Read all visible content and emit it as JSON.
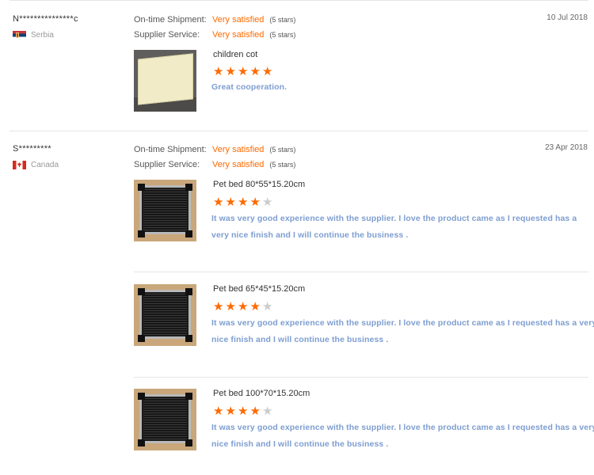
{
  "reviews": [
    {
      "reviewer": "N***************c",
      "country": "Serbia",
      "date": "10 Jul 2018",
      "shipment": {
        "label": "On-time Shipment:",
        "value": "Very satisfied",
        "stars_text": "(5 stars)"
      },
      "service": {
        "label": "Supplier Service:",
        "value": "Very satisfied",
        "stars_text": "(5 stars)"
      },
      "products": [
        {
          "name": "children cot",
          "rating": 5,
          "comment_lines": [
            "Great cooperation."
          ]
        }
      ]
    },
    {
      "reviewer": "S*********",
      "country": "Canada",
      "date": "23 Apr 2018",
      "shipment": {
        "label": "On-time Shipment:",
        "value": "Very satisfied",
        "stars_text": "(5 stars)"
      },
      "service": {
        "label": "Supplier Service:",
        "value": "Very satisfied",
        "stars_text": "(5 stars)"
      },
      "products": [
        {
          "name": "Pet bed 80*55*15.20cm",
          "rating": 4,
          "comment_lines": [
            "It was very good experience with the supplier. I love the product came as I requested has a",
            "very nice finish and I will continue the business ."
          ]
        },
        {
          "name": "Pet bed 65*45*15.20cm",
          "rating": 4,
          "comment_lines": [
            "It was very good experience with the supplier. I love the product came as I requested has a very",
            "nice finish and I will continue the business ."
          ]
        },
        {
          "name": "Pet bed 100*70*15.20cm",
          "rating": 4,
          "comment_lines": [
            "It was very good experience with the supplier. I love the product came as I requested has a very",
            "nice finish and I will continue the business ."
          ]
        }
      ]
    }
  ]
}
